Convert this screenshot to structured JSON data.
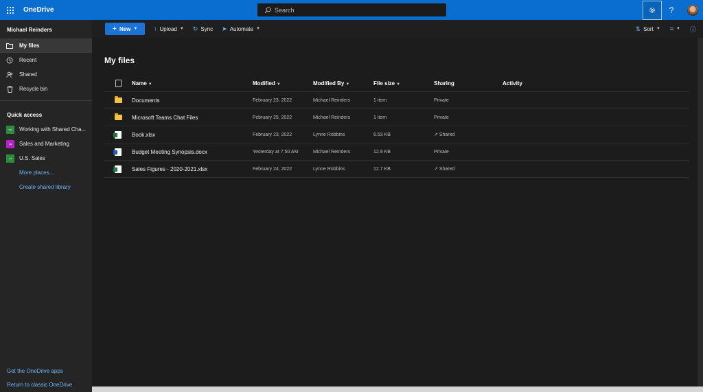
{
  "app": {
    "name": "OneDrive"
  },
  "search": {
    "placeholder": "Search"
  },
  "topbar": {
    "help": "?"
  },
  "sidebar": {
    "user": "Michael Reinders",
    "nav": [
      {
        "label": "My files",
        "icon": "folder-icon"
      },
      {
        "label": "Recent",
        "icon": "clock-icon"
      },
      {
        "label": "Shared",
        "icon": "people-icon"
      },
      {
        "label": "Recycle bin",
        "icon": "trash-icon"
      }
    ],
    "quick_access_title": "Quick access",
    "quick_access": [
      {
        "label": "Working with Shared Cha...",
        "badge": "WS",
        "color": "#2e8b3e"
      },
      {
        "label": "Sales and Marketing",
        "badge": "SM",
        "color": "#b423c3"
      },
      {
        "label": "U.S. Sales",
        "badge": "US",
        "color": "#2e8b3e"
      }
    ],
    "more_places": "More places...",
    "create_library": "Create shared library",
    "bottom_links": [
      "Get the OneDrive apps",
      "Return to classic OneDrive"
    ]
  },
  "commandbar": {
    "new_label": "New",
    "upload_label": "Upload",
    "sync_label": "Sync",
    "automate_label": "Automate",
    "sort_label": "Sort"
  },
  "main": {
    "title": "My files",
    "columns": [
      "Name",
      "Modified",
      "Modified By",
      "File size",
      "Sharing",
      "Activity"
    ],
    "rows": [
      {
        "type": "folder",
        "name": "Documents",
        "modified": "February 23, 2022",
        "by": "Michael Reinders",
        "size": "1 item",
        "sharing": "Private"
      },
      {
        "type": "folder",
        "name": "Microsoft Teams Chat Files",
        "modified": "February 25, 2022",
        "by": "Michael Reinders",
        "size": "1 item",
        "sharing": "Private"
      },
      {
        "type": "excel",
        "name": "Book.xlsx",
        "modified": "February 23, 2022",
        "by": "Lynne Robbins",
        "size": "6.53 KB",
        "sharing": "Shared"
      },
      {
        "type": "word",
        "name": "Budget Meeting Synopsis.docx",
        "modified": "Yesterday at 7:50 AM",
        "by": "Michael Reinders",
        "size": "12.9 KB",
        "sharing": "Private"
      },
      {
        "type": "excel",
        "name": "Sales Figures - 2020-2021.xlsx",
        "modified": "February 24, 2022",
        "by": "Lynne Robbins",
        "size": "12.7 KB",
        "sharing": "Shared"
      }
    ]
  }
}
